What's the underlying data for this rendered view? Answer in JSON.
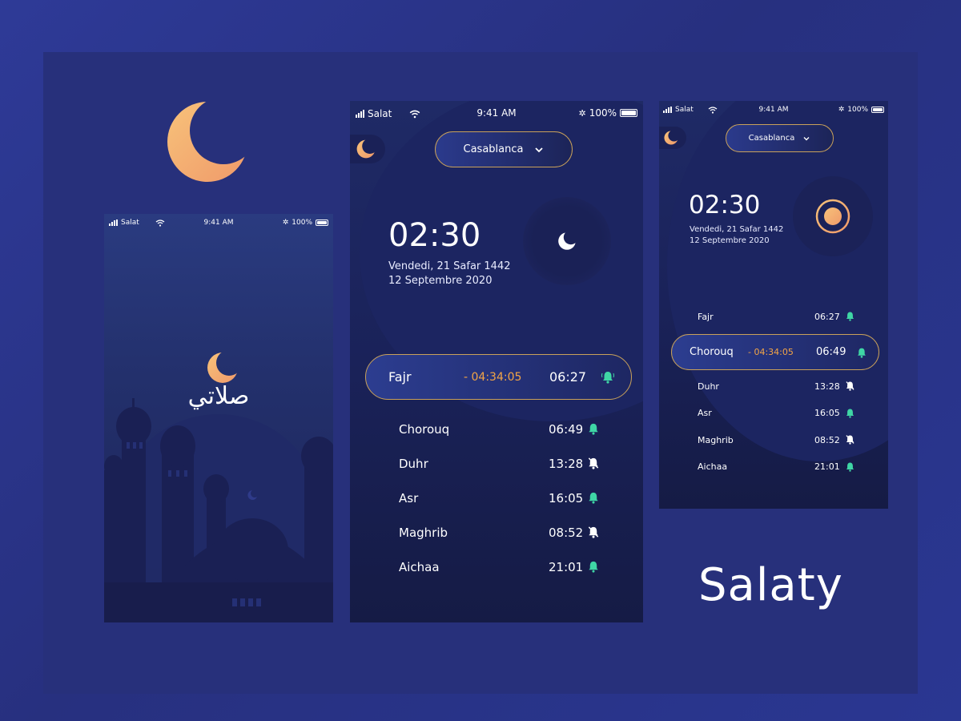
{
  "brand": {
    "title": "Salaty"
  },
  "colors": {
    "accent": "#f3a546",
    "bell_on": "#3fd6a5",
    "bell_off": "#ffffff",
    "border_gold": "#c9a15a"
  },
  "status": {
    "carrier": "Salat",
    "time": "9:41 AM",
    "battery": "100%"
  },
  "splash": {
    "app_name_ar": "صلاتي"
  },
  "main": {
    "city": "Casablanca",
    "clock": "02:30",
    "date_hijri": "Vendedi, 21 Safar 1442",
    "date_gregorian": "12 Septembre 2020",
    "active_prayer": {
      "name": "Fajr",
      "countdown": "- 04:34:05",
      "time": "06:27",
      "bell": "on"
    },
    "prayers": [
      {
        "name": "Chorouq",
        "time": "06:49",
        "bell": "on"
      },
      {
        "name": "Duhr",
        "time": "13:28",
        "bell": "off"
      },
      {
        "name": "Asr",
        "time": "16:05",
        "bell": "on"
      },
      {
        "name": "Maghrib",
        "time": "08:52",
        "bell": "off"
      },
      {
        "name": "Aichaa",
        "time": "21:01",
        "bell": "on"
      }
    ]
  },
  "alt": {
    "city": "Casablanca",
    "clock": "02:30",
    "date_hijri": "Vendedi, 21 Safar 1442",
    "date_gregorian": "12 Septembre 2020",
    "first_prayer": {
      "name": "Fajr",
      "time": "06:27",
      "bell": "on"
    },
    "active_prayer": {
      "name": "Chorouq",
      "countdown": "- 04:34:05",
      "time": "06:49",
      "bell": "on"
    },
    "prayers": [
      {
        "name": "Duhr",
        "time": "13:28",
        "bell": "off"
      },
      {
        "name": "Asr",
        "time": "16:05",
        "bell": "on"
      },
      {
        "name": "Maghrib",
        "time": "08:52",
        "bell": "off"
      },
      {
        "name": "Aichaa",
        "time": "21:01",
        "bell": "on"
      }
    ]
  }
}
